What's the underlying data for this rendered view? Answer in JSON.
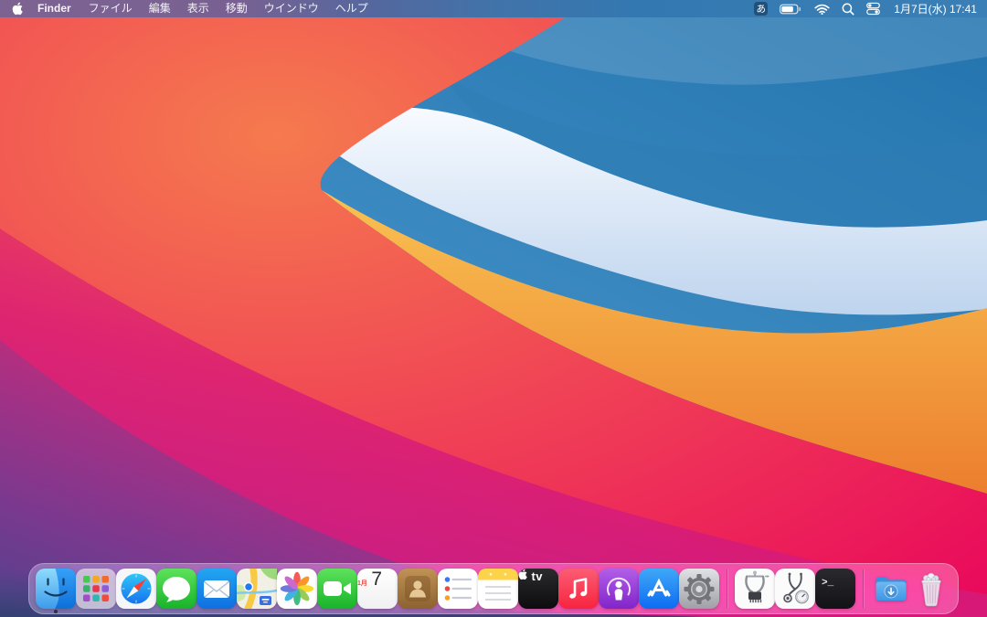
{
  "menu_bar": {
    "app_name": "Finder",
    "menus": [
      "ファイル",
      "編集",
      "表示",
      "移動",
      "ウインドウ",
      "ヘルプ"
    ],
    "status": {
      "input_source": "あ",
      "icons": [
        "battery-icon",
        "wifi-icon",
        "spotlight-search-icon",
        "control-center-icon"
      ],
      "clock": "1月7日(水) 17:41"
    }
  },
  "dock": {
    "items": [
      {
        "name": "Finder",
        "running": true
      },
      {
        "name": "Launchpad"
      },
      {
        "name": "Safari"
      },
      {
        "name": "Messages"
      },
      {
        "name": "Mail"
      },
      {
        "name": "Maps"
      },
      {
        "name": "Photos"
      },
      {
        "name": "FaceTime"
      },
      {
        "name": "Calendar",
        "month": "1月",
        "day": "7"
      },
      {
        "name": "Contacts"
      },
      {
        "name": "Reminders"
      },
      {
        "name": "Notes"
      },
      {
        "name": "TV",
        "label": "tv"
      },
      {
        "name": "Music"
      },
      {
        "name": "Podcasts"
      },
      {
        "name": "App Store"
      },
      {
        "name": "System Preferences"
      },
      {
        "name": "Utility app (calipers and chip icon)"
      },
      {
        "name": "Utility app (stethoscope icon)"
      },
      {
        "name": "Terminal",
        "label": ">_"
      },
      {
        "name": "Downloads"
      },
      {
        "name": "Trash",
        "full": true
      }
    ]
  },
  "wallpaper": {
    "name": "macOS Big Sur abstract waves",
    "palette": [
      "#2273ae",
      "#f8fbff",
      "#f9c252",
      "#f04056",
      "#bc2090",
      "#54418d"
    ]
  },
  "colors": {
    "menu_bar_left": "#7d6392",
    "menu_bar_right": "#3a7fb5",
    "dock_tint": "rgba(248,240,248,0.30)"
  }
}
